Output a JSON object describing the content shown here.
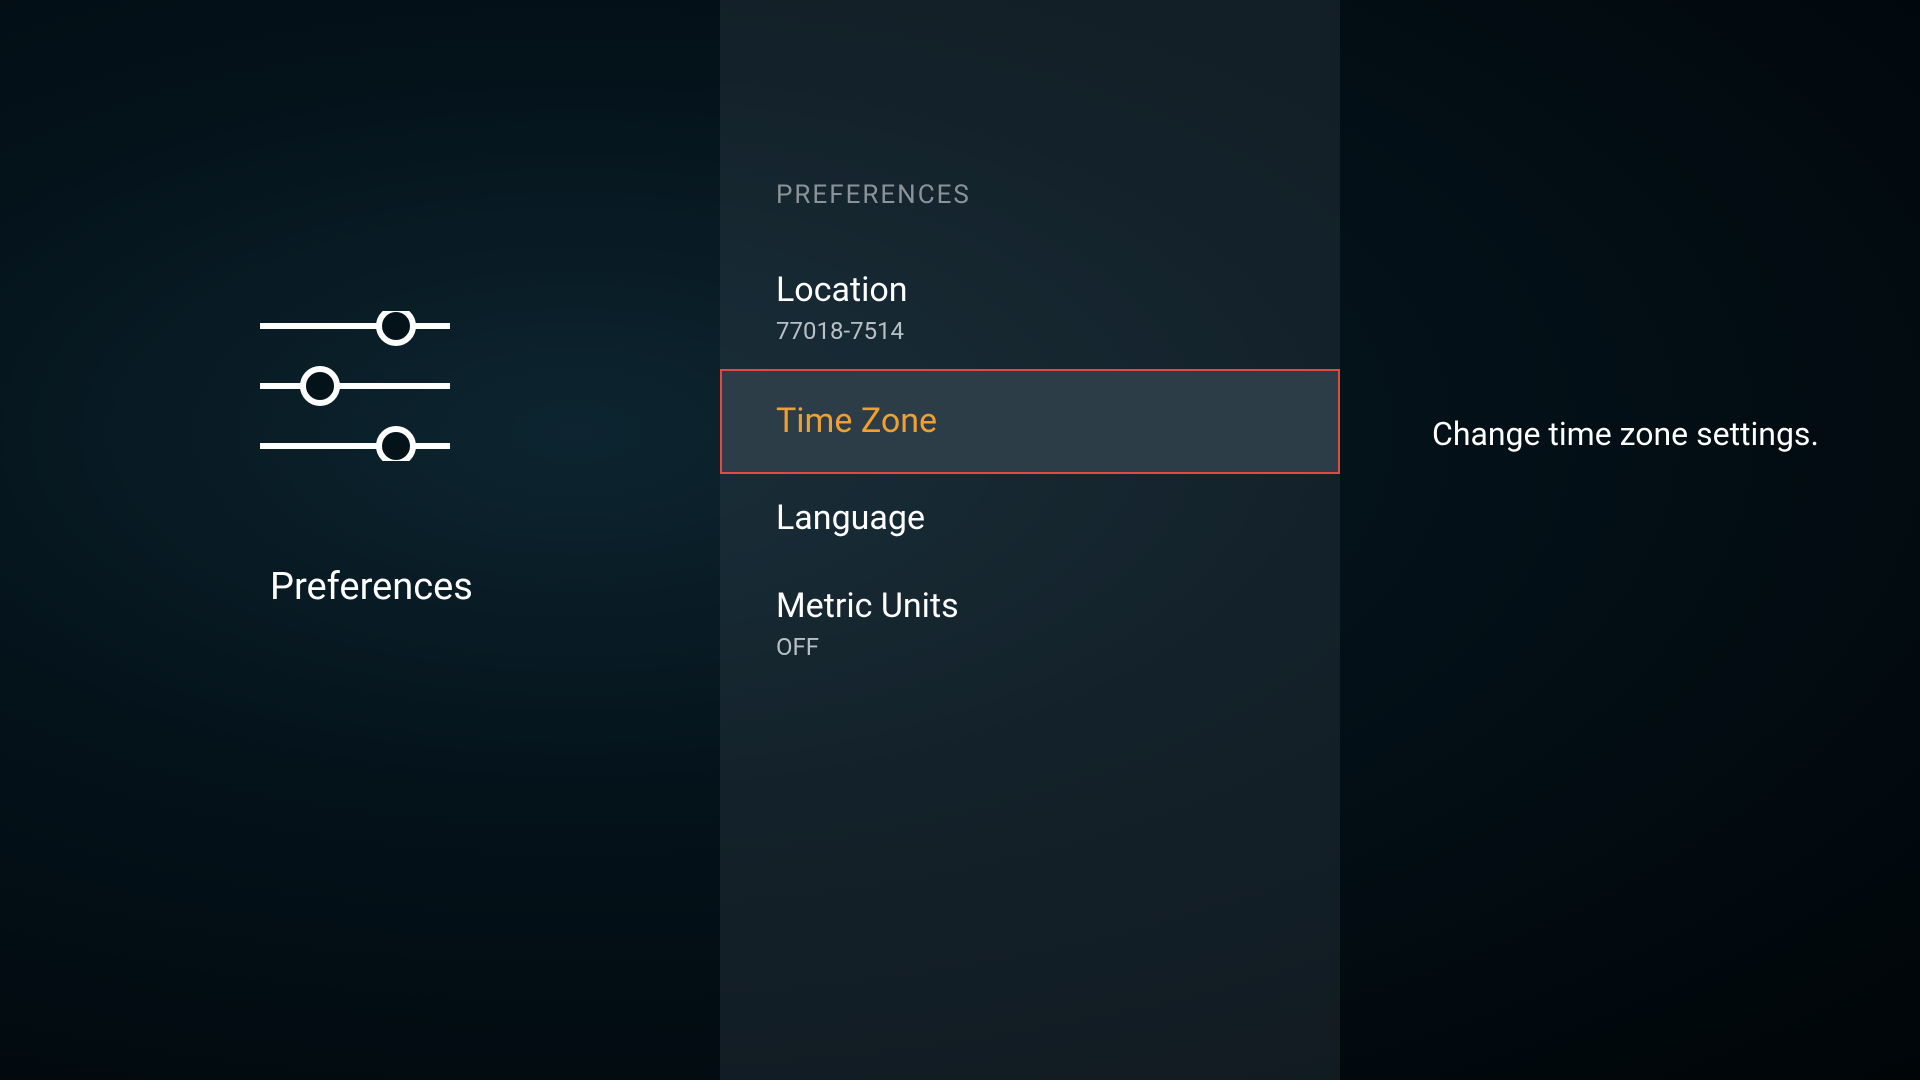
{
  "left": {
    "title": "Preferences"
  },
  "center": {
    "header": "PREFERENCES",
    "items": [
      {
        "title": "Location",
        "subtitle": "77018-7514",
        "selected": false
      },
      {
        "title": "Time Zone",
        "subtitle": "",
        "selected": true
      },
      {
        "title": "Language",
        "subtitle": "",
        "selected": false
      },
      {
        "title": "Metric Units",
        "subtitle": "OFF",
        "selected": false
      }
    ]
  },
  "right": {
    "description": "Change time zone settings."
  }
}
